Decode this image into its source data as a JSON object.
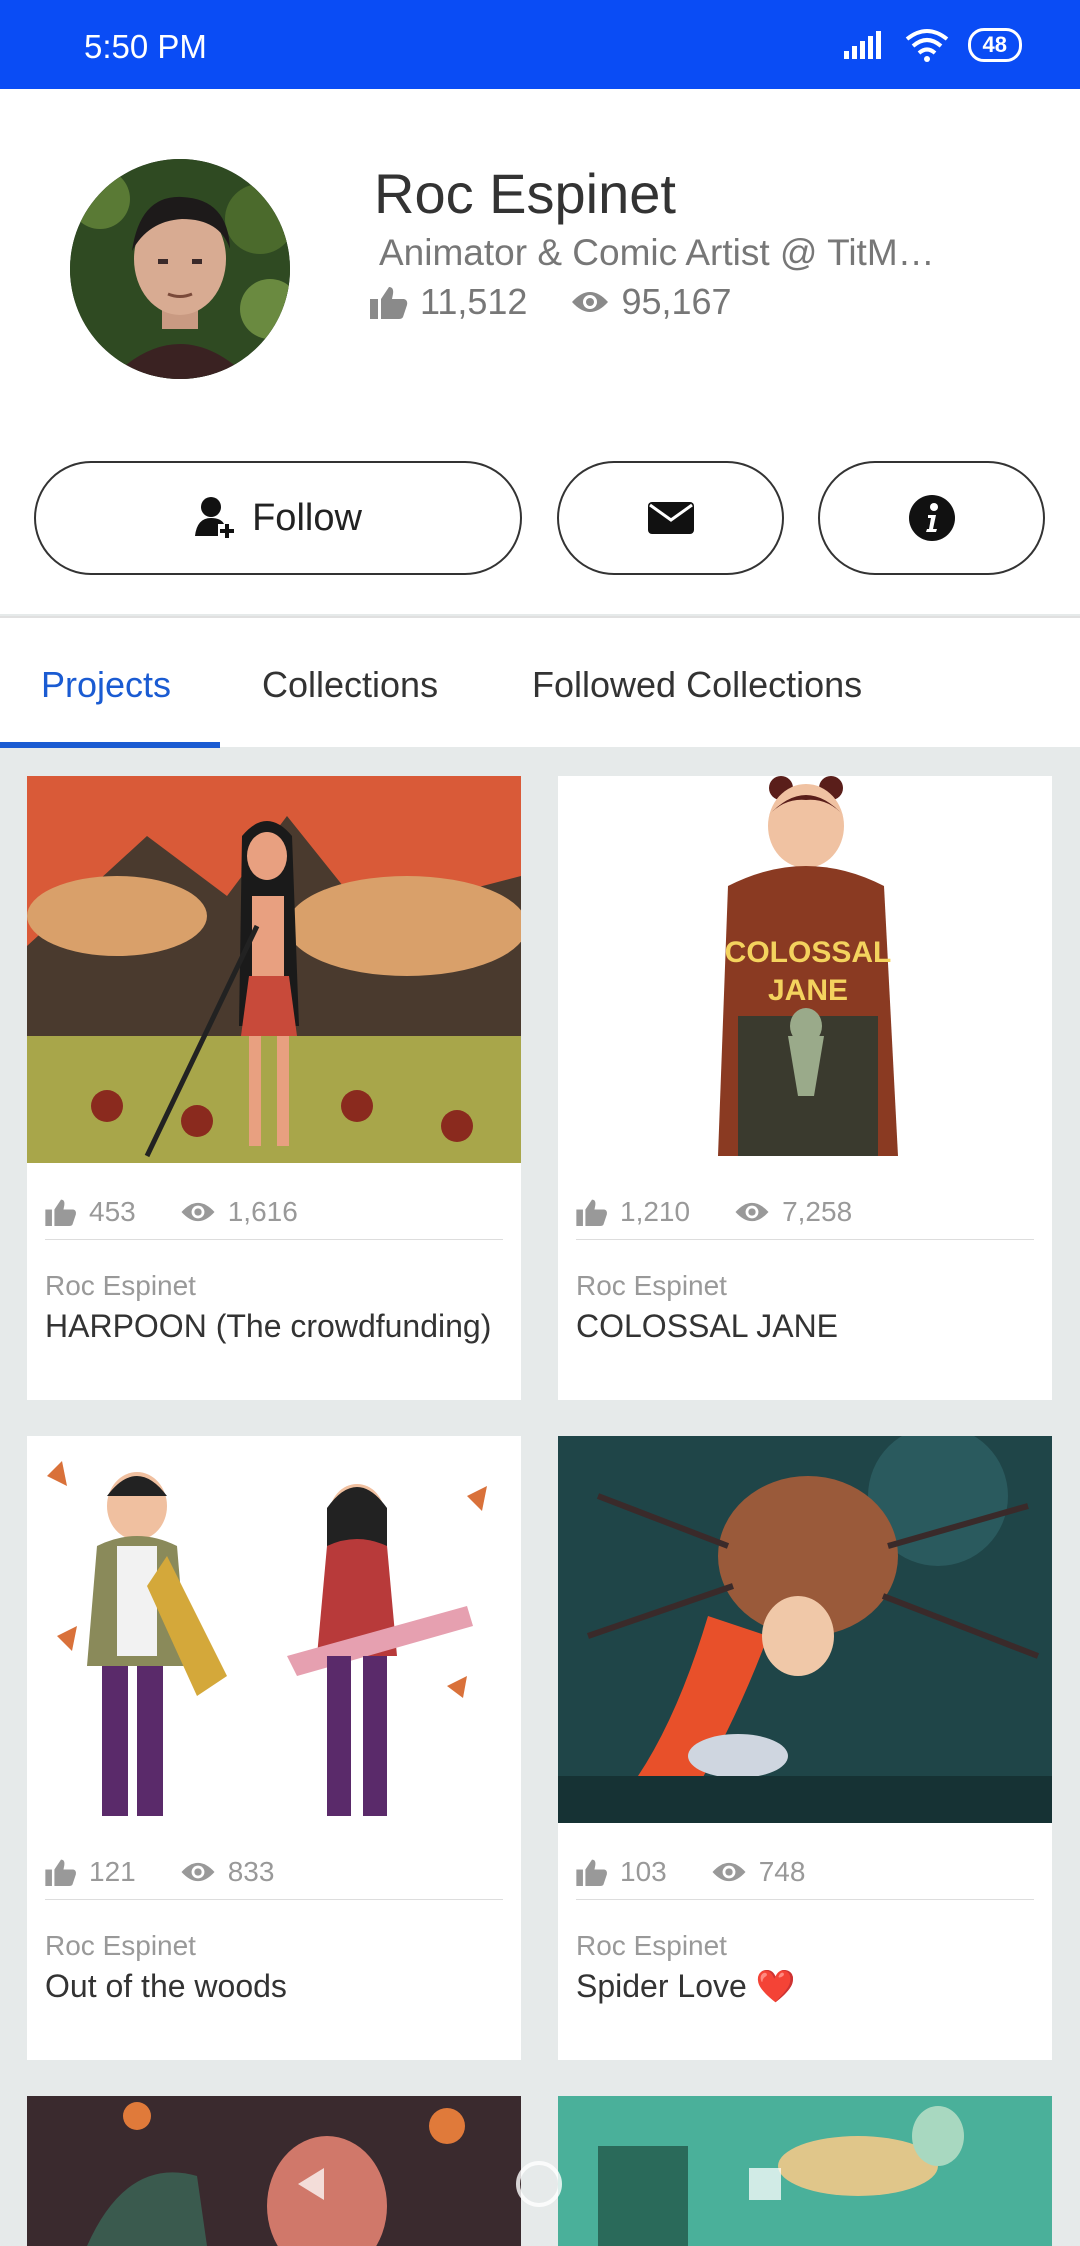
{
  "status": {
    "time": "5:50 PM",
    "battery": "48"
  },
  "profile": {
    "name": "Roc Espinet",
    "bio": "Animator & Comic Artist @ TitM…",
    "likes": "11,512",
    "views": "95,167"
  },
  "actions": {
    "follow_label": "Follow"
  },
  "tabs": [
    {
      "label": "Projects"
    },
    {
      "label": "Collections"
    },
    {
      "label": "Followed Collections"
    }
  ],
  "projects": [
    {
      "owner": "Roc Espinet",
      "title": "HARPOON (The crowdfunding)",
      "likes": "453",
      "views": "1,616"
    },
    {
      "owner": "Roc Espinet",
      "title": "COLOSSAL JANE",
      "likes": "1,210",
      "views": "7,258",
      "cover_text": "COLOSSAL\nJANE"
    },
    {
      "owner": "Roc Espinet",
      "title": "Out of the woods",
      "likes": "121",
      "views": "833"
    },
    {
      "owner": "Roc Espinet",
      "title": "Spider Love ❤️",
      "likes": "103",
      "views": "748"
    }
  ],
  "colors": {
    "status_bar": "#0a4cf5",
    "accent": "#1a5bd2"
  },
  "icons": {
    "like": "thumbs-up-icon",
    "views": "eye-icon",
    "follow": "add-user-icon",
    "message": "envelope-icon",
    "info": "info-icon"
  }
}
